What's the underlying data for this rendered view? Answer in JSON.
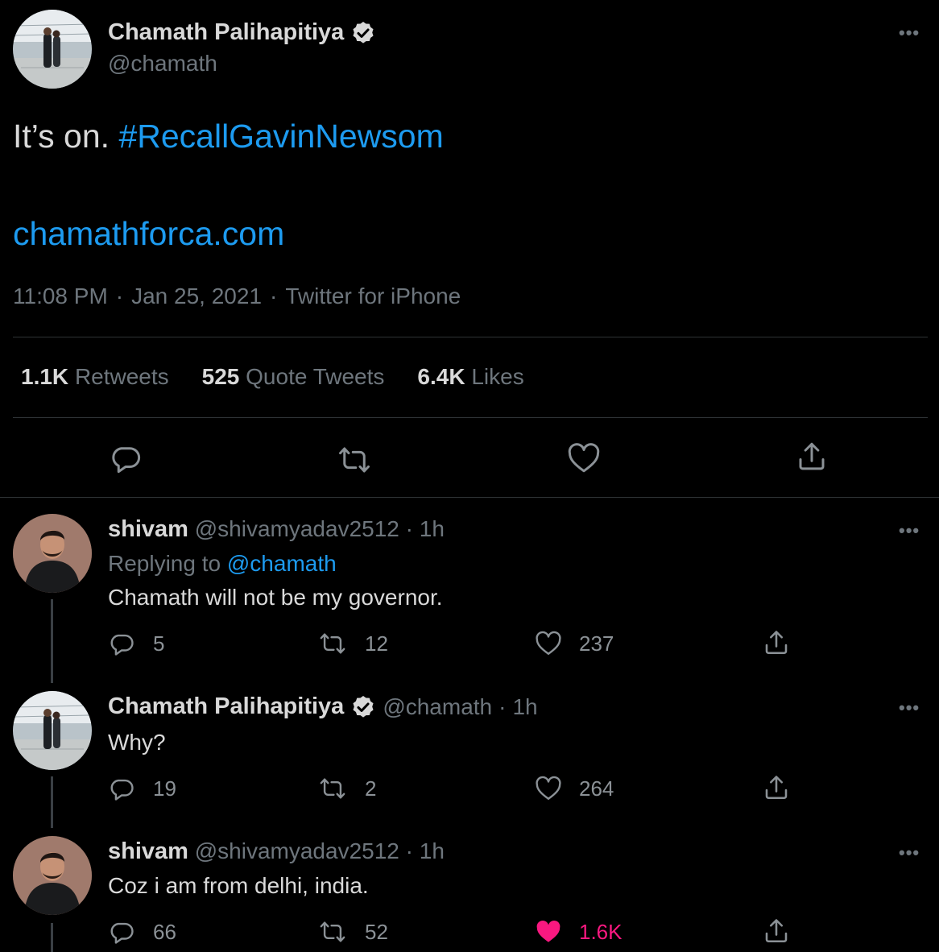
{
  "main_tweet": {
    "author_name": "Chamath Palihapitiya",
    "handle": "@chamath",
    "text_plain": "It’s on.",
    "hashtag": "#RecallGavinNewsom",
    "link": "chamathforca.com",
    "time": "11:08 PM",
    "date": "Jan 25, 2021",
    "source": "Twitter for iPhone",
    "sep": "·",
    "stats": {
      "retweets_count": "1.1K",
      "retweets_label": "Retweets",
      "quotes_count": "525",
      "quotes_label": "Quote Tweets",
      "likes_count": "6.4K",
      "likes_label": "Likes"
    }
  },
  "replies": [
    {
      "author_name": "shivam",
      "handle": "@shivamyadav2512",
      "time": "1h",
      "replying_prefix": "Replying to",
      "replying_handle": "@chamath",
      "text": "Chamath will not be my governor.",
      "reply_count": "5",
      "retweet_count": "12",
      "like_count": "237",
      "liked": false
    },
    {
      "author_name": "Chamath Palihapitiya",
      "handle": "@chamath",
      "time": "1h",
      "text": "Why?",
      "reply_count": "19",
      "retweet_count": "2",
      "like_count": "264",
      "liked": false
    },
    {
      "author_name": "shivam",
      "handle": "@shivamyadav2512",
      "time": "1h",
      "text": "Coz i am from delhi, india.",
      "reply_count": "66",
      "retweet_count": "52",
      "like_count": "1.6K",
      "liked": true
    }
  ],
  "more_label": "•••",
  "colors": {
    "accent": "#1d9bf0",
    "like_active": "#f91880",
    "muted": "#6e767d",
    "background": "#000000"
  }
}
